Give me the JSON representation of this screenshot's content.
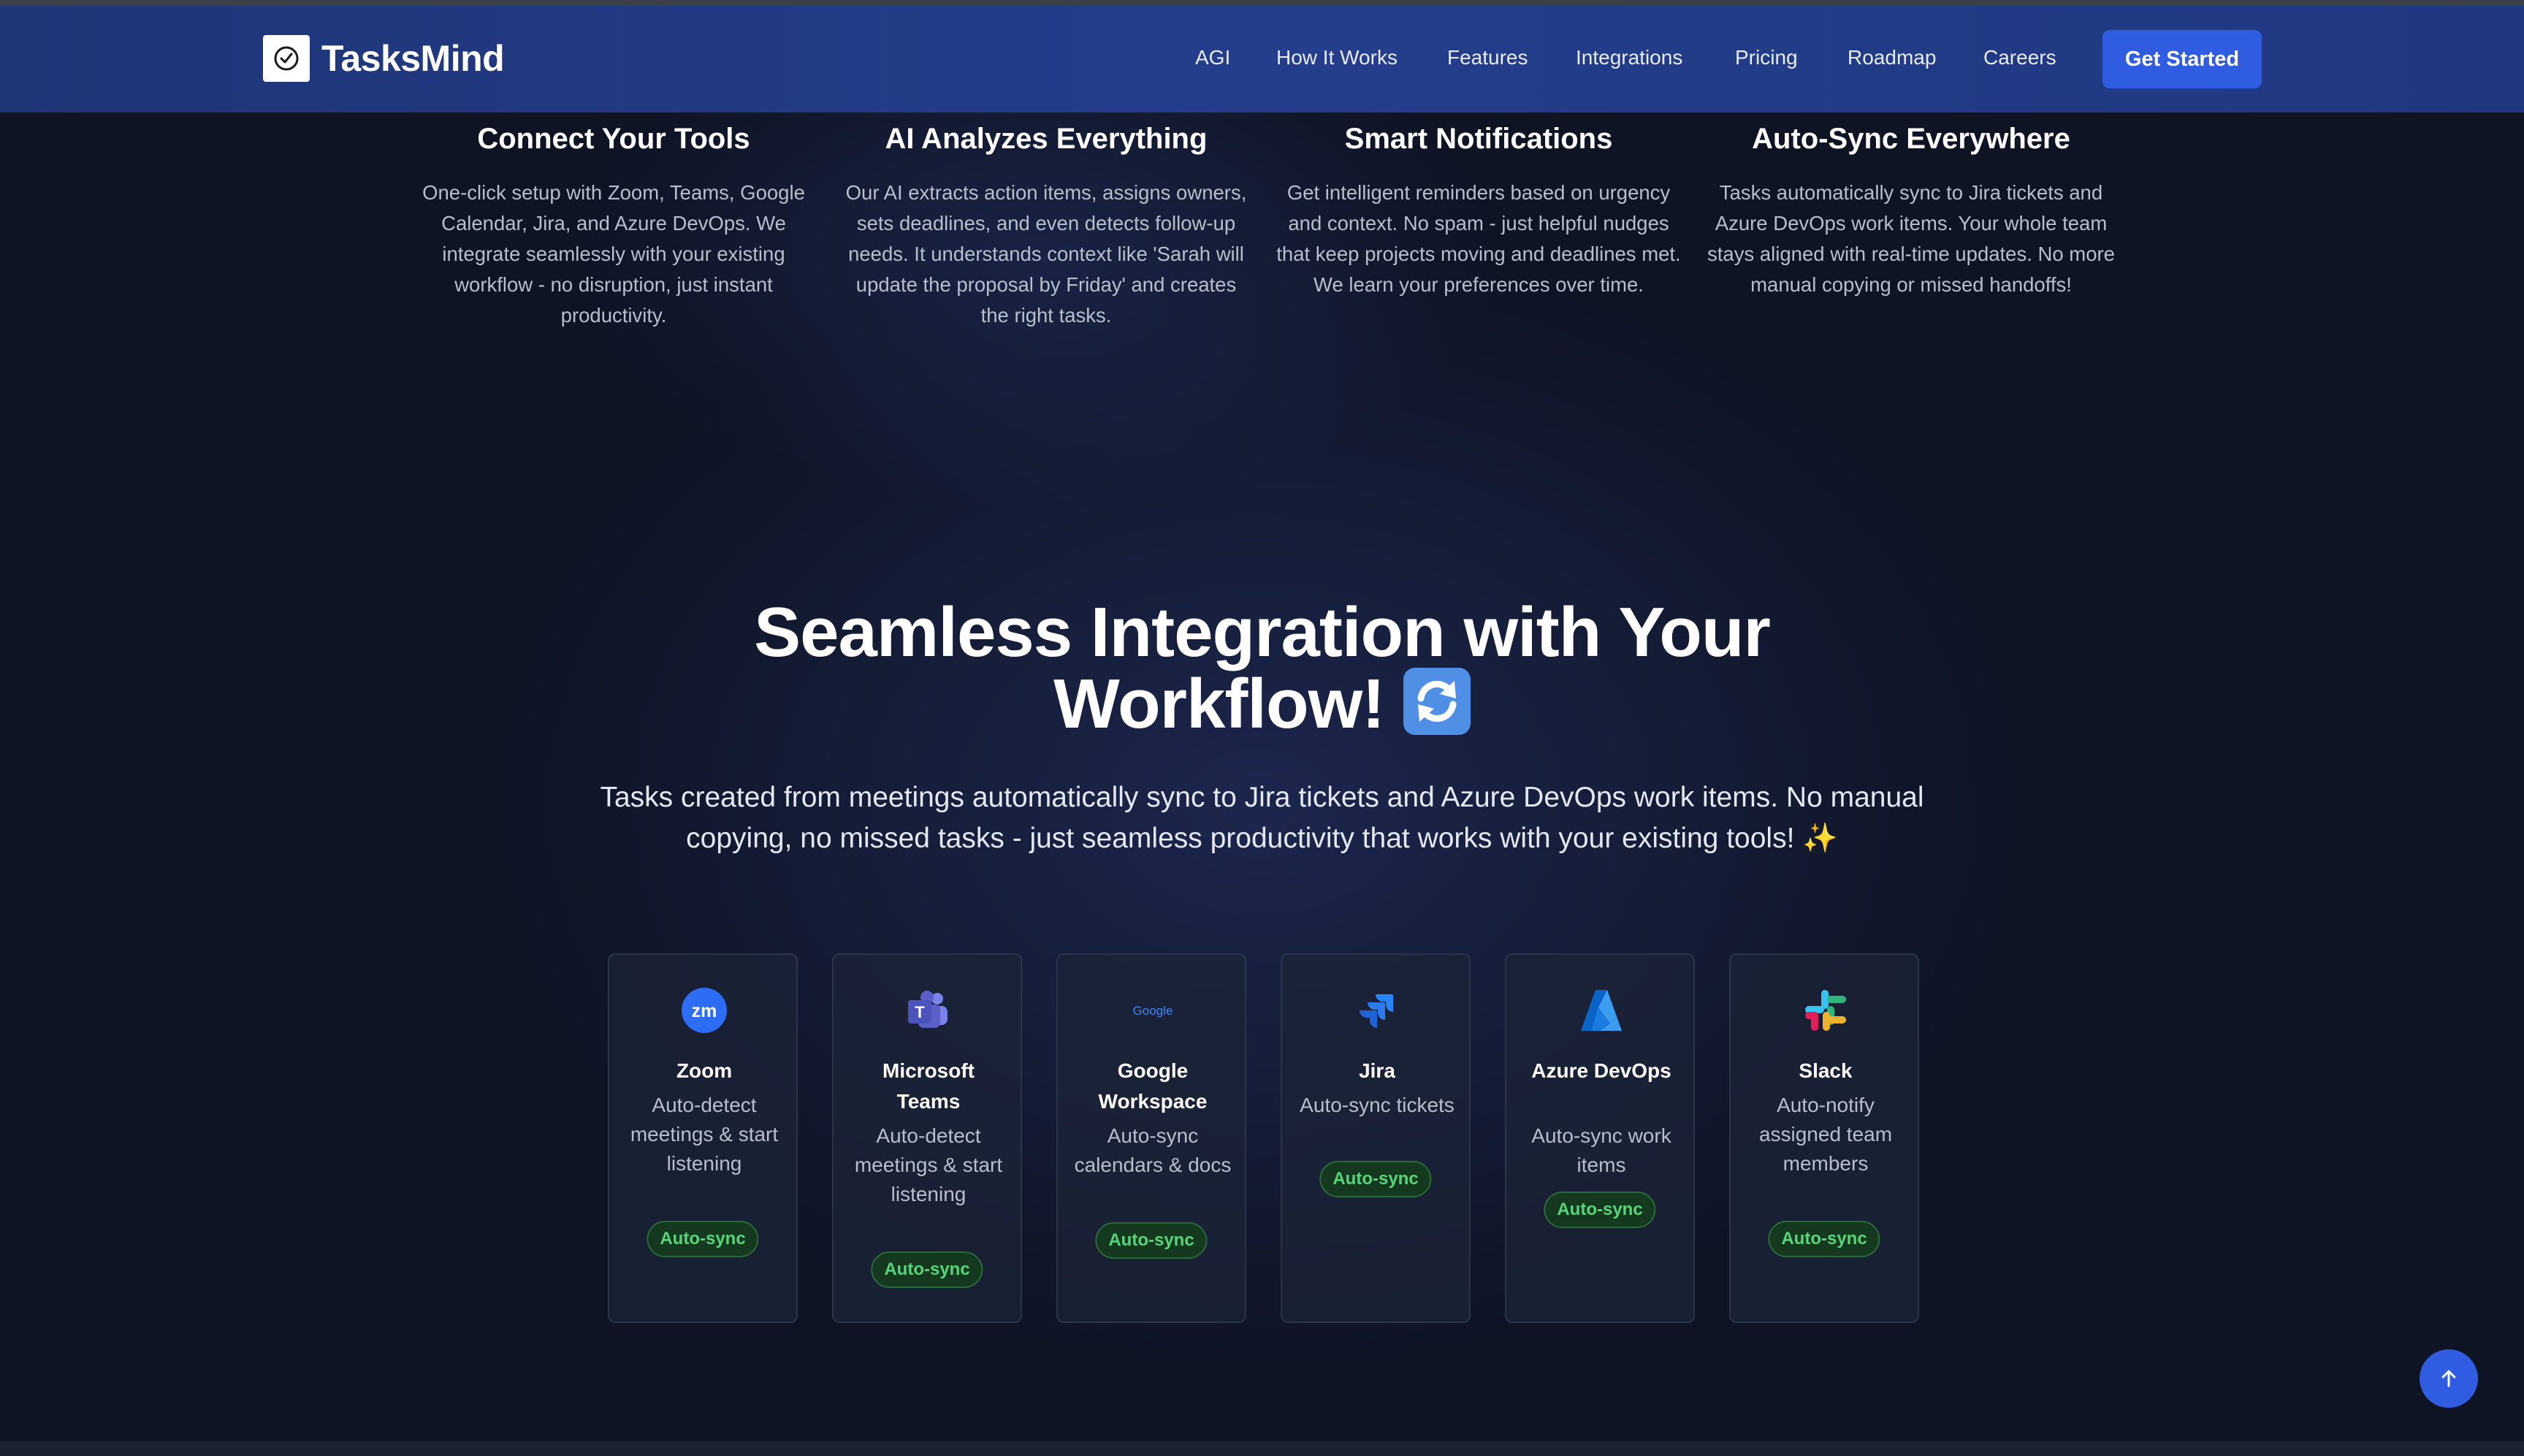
{
  "brand": {
    "name": "TasksMind"
  },
  "nav": {
    "items": [
      "AGI",
      "How It Works",
      "Features",
      "Integrations",
      "Pricing",
      "Roadmap",
      "Careers"
    ],
    "cta": "Get Started"
  },
  "steps": [
    {
      "title": "Connect Your Tools",
      "desc": "One-click setup with Zoom, Teams, Google Calendar, Jira, and Azure DevOps. We integrate seamlessly with your existing workflow - no disruption, just instant productivity."
    },
    {
      "title": "AI Analyzes Everything",
      "desc": "Our AI extracts action items, assigns owners, sets deadlines, and even detects follow-up needs. It understands context like 'Sarah will update the proposal by Friday' and creates the right tasks."
    },
    {
      "title": "Smart Notifications",
      "desc": "Get intelligent reminders based on urgency and context. No spam - just helpful nudges that keep projects moving and deadlines met. We learn your preferences over time."
    },
    {
      "title": "Auto-Sync Everywhere",
      "desc": "Tasks automatically sync to Jira tickets and Azure DevOps work items. Your whole team stays aligned with real-time updates. No more manual copying or missed handoffs!"
    }
  ],
  "integrations": {
    "title_line1": "Seamless Integration with Your",
    "title_line2": "Workflow!",
    "subtitle": "Tasks created from meetings automatically sync to Jira tickets and Azure DevOps work items. No manual copying, no missed tasks - just seamless productivity that works with your existing tools!",
    "sparkle": "✨",
    "cards": [
      {
        "name": "Zoom",
        "desc": "Auto-detect meetings & start listening",
        "badge": "Auto-sync",
        "icon": "zoom-icon"
      },
      {
        "name": "Microsoft Teams",
        "desc": "Auto-detect meetings & start listening",
        "badge": "Auto-sync",
        "icon": "microsoft-teams-icon"
      },
      {
        "name": "Google Workspace",
        "desc": "Auto-sync calendars & docs",
        "badge": "Auto-sync",
        "icon": "google-icon",
        "icon_text": "Google"
      },
      {
        "name": "Jira",
        "desc": "Auto-sync tickets",
        "badge": "Auto-sync",
        "icon": "jira-icon"
      },
      {
        "name": "Azure DevOps",
        "desc": "Auto-sync work items",
        "badge": "Auto-sync",
        "icon": "azure-icon"
      },
      {
        "name": "Slack",
        "desc": "Auto-notify assigned team members",
        "badge": "Auto-sync",
        "icon": "slack-icon"
      }
    ]
  },
  "colors": {
    "accent": "#2f5ce0",
    "badge_text": "#58d47a",
    "background": "#0e1424"
  }
}
